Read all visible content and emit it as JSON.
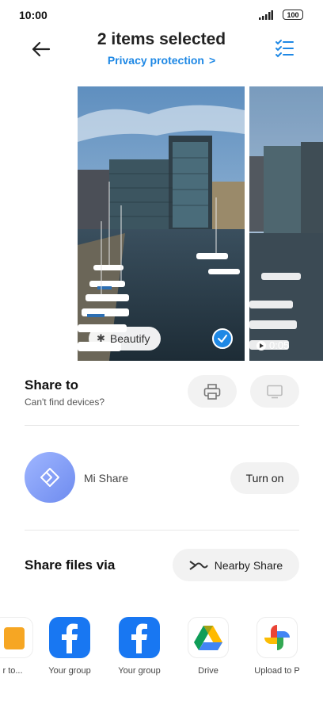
{
  "status_bar": {
    "time": "10:00",
    "battery": "100"
  },
  "header": {
    "title": "2 items selected",
    "privacy_link": "Privacy protection",
    "privacy_chevron": ">"
  },
  "preview": {
    "beautify_label": "Beautify",
    "video_duration": "0:05"
  },
  "share_to": {
    "title": "Share to",
    "subtitle": "Can't find devices?"
  },
  "mi_share": {
    "label": "Mi Share",
    "button": "Turn on"
  },
  "share_files": {
    "title": "Share files via",
    "nearby_button": "Nearby Share"
  },
  "apps": [
    {
      "label": "r to...",
      "icon": "partial-yellow-icon"
    },
    {
      "label": "Your group",
      "icon": "facebook-icon"
    },
    {
      "label": "Your group",
      "icon": "facebook-icon"
    },
    {
      "label": "Drive",
      "icon": "google-drive-icon"
    },
    {
      "label": "Upload to P",
      "icon": "google-photos-icon"
    }
  ],
  "colors": {
    "accent": "#1e88e5",
    "facebook": "#1877f2",
    "mi_gradient_start": "#9fb6ff",
    "mi_gradient_end": "#6e8bef"
  }
}
